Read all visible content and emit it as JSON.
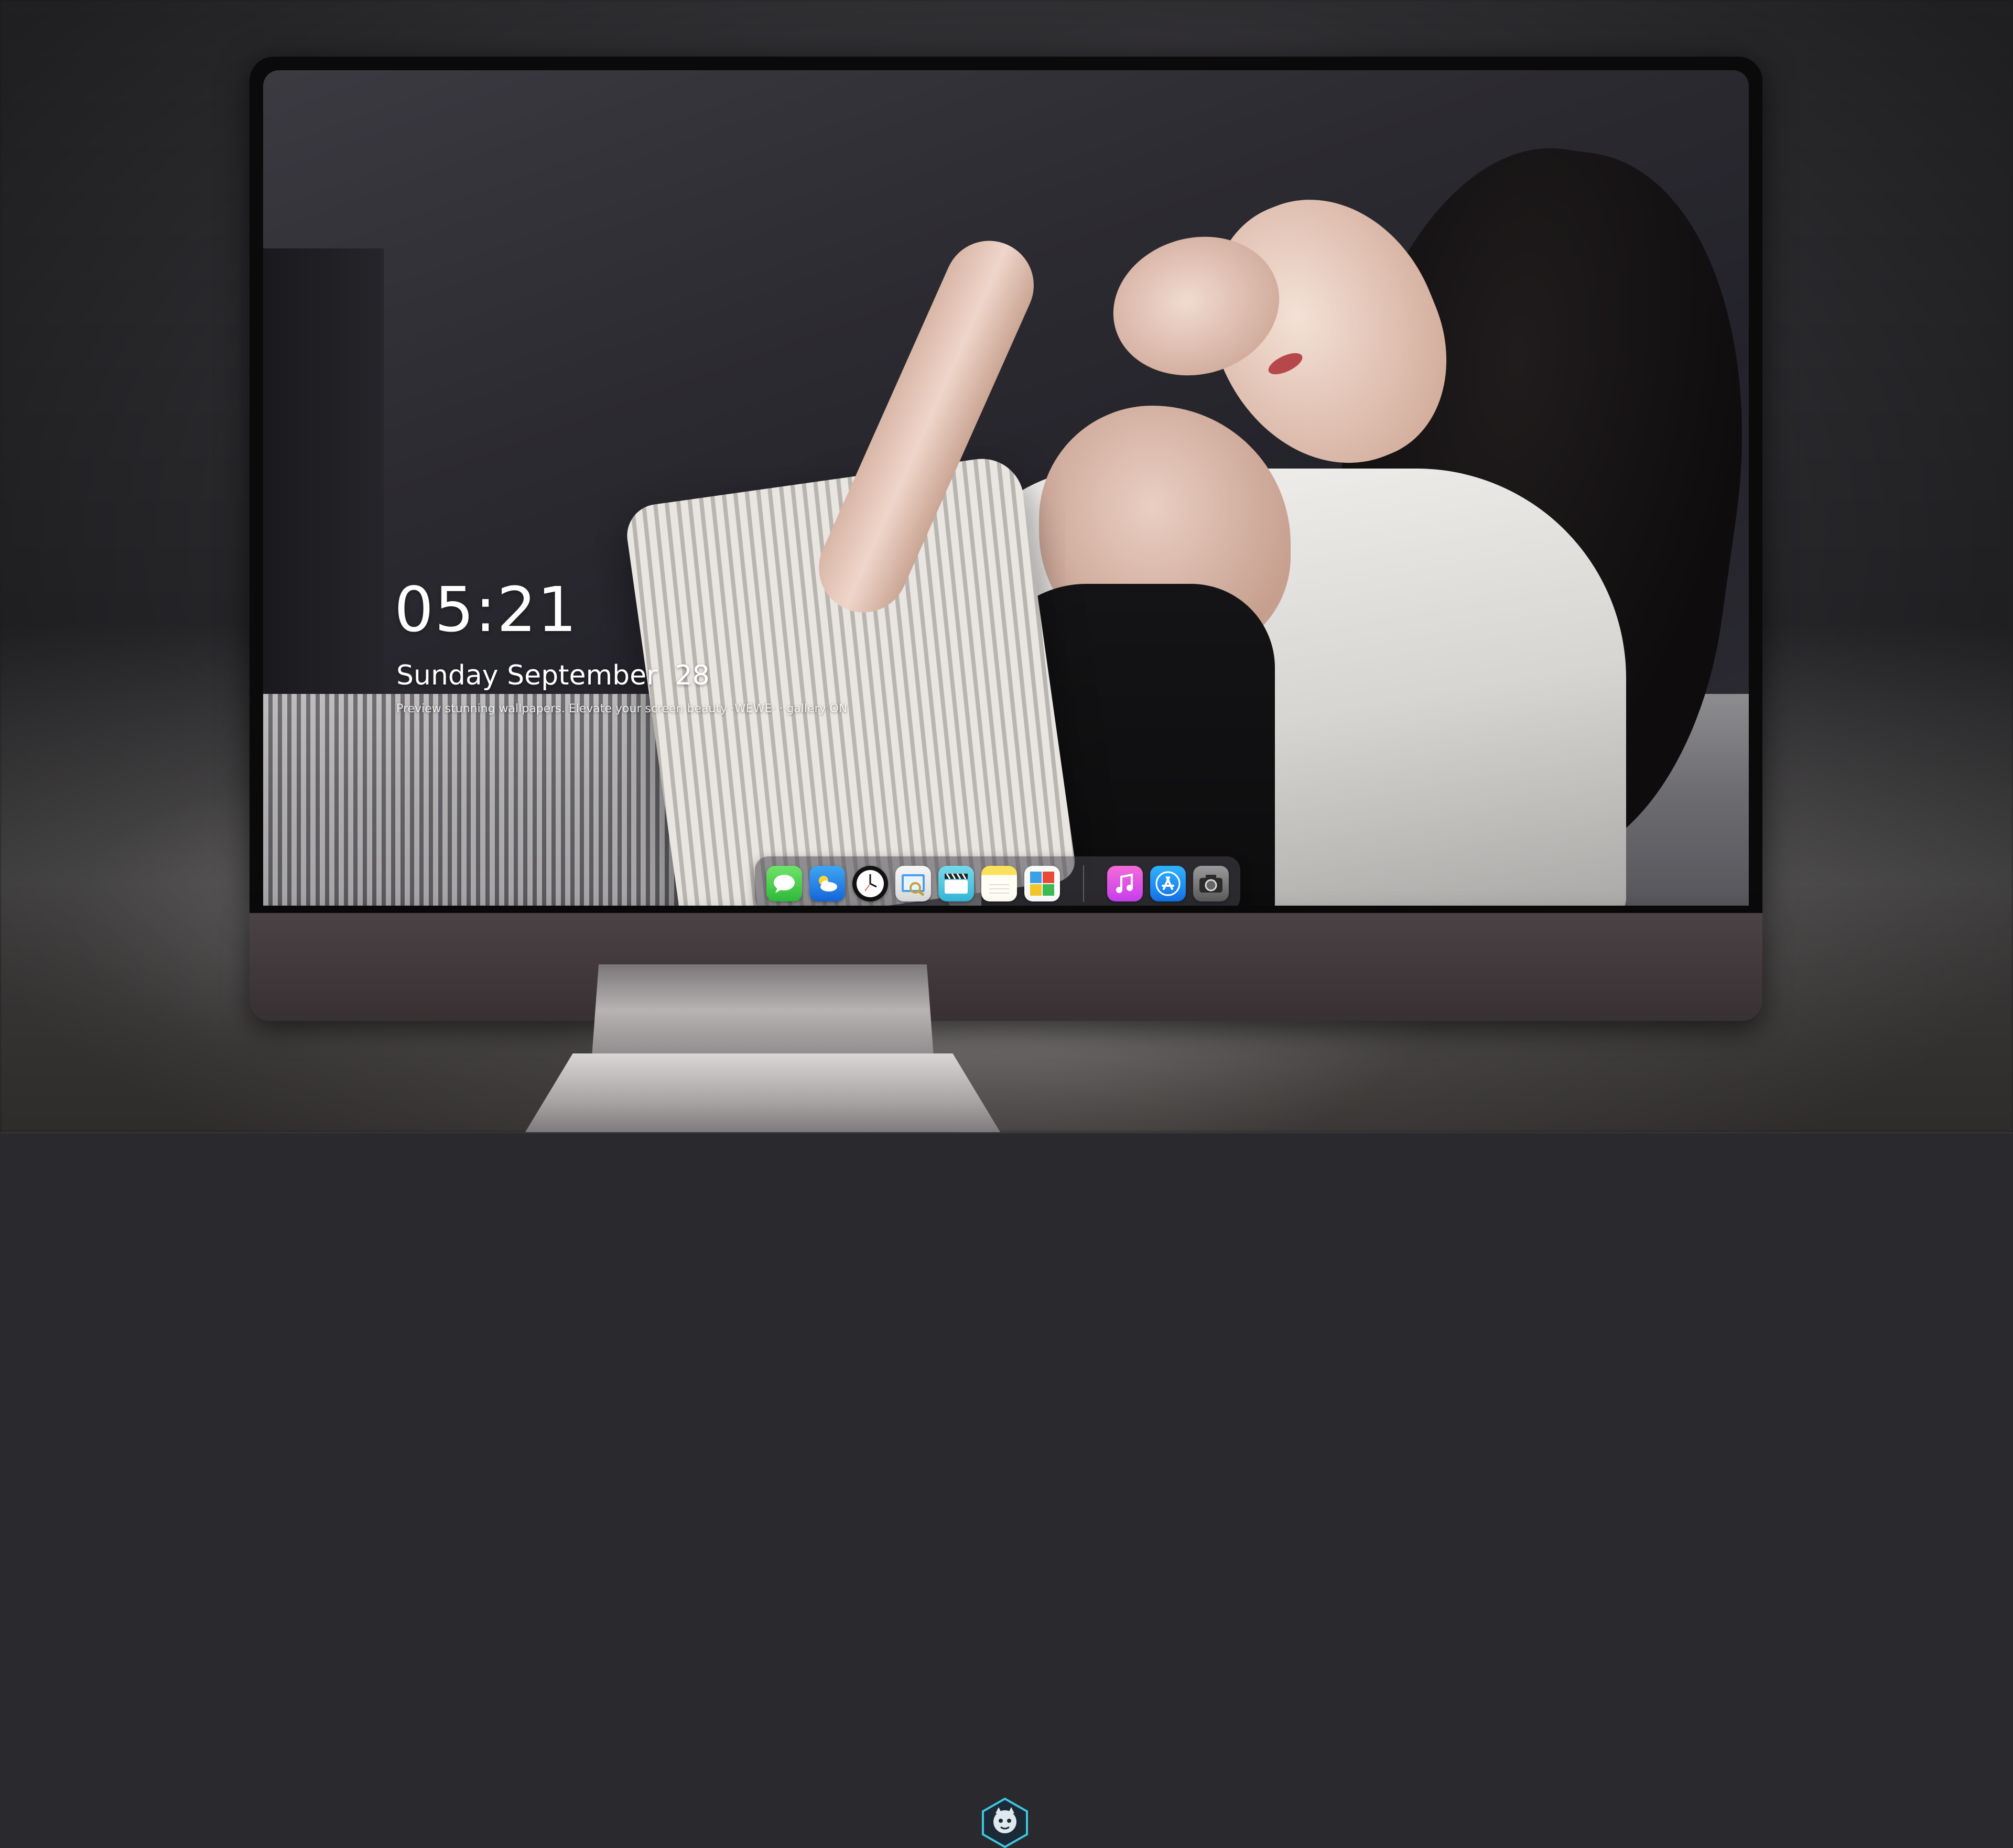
{
  "lockscreen": {
    "time": "05:21",
    "date": "Sunday September  28",
    "tagline": "Preview stunning wallpapers. Elevate your screen beauty ·WEWE· · gallery ON"
  },
  "dock": {
    "apps": [
      {
        "name": "Messages",
        "icon": "messages-icon"
      },
      {
        "name": "Weather",
        "icon": "weather-icon"
      },
      {
        "name": "Clock",
        "icon": "clock-icon"
      },
      {
        "name": "Preview",
        "icon": "preview-icon"
      },
      {
        "name": "Clips",
        "icon": "clapperboard-icon"
      },
      {
        "name": "Notes",
        "icon": "notes-icon"
      },
      {
        "name": "Calculator",
        "icon": "calculator-icon"
      },
      {
        "name": "Music",
        "icon": "music-icon"
      },
      {
        "name": "App Store",
        "icon": "app-store-icon"
      },
      {
        "name": "Camera",
        "icon": "camera-icon"
      }
    ]
  },
  "colors": {
    "bezel": "#0a0a0b",
    "chin": "#433b3d",
    "clock_text": "#ffffff",
    "logo_accent": "#3ec6e0"
  }
}
